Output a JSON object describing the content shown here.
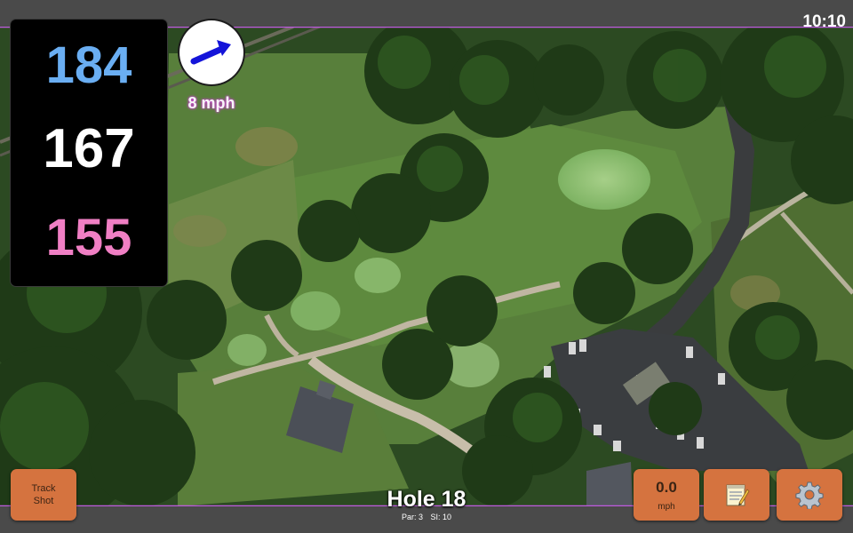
{
  "status_bar": {
    "time": "10:10"
  },
  "distances": {
    "back": "184",
    "middle": "167",
    "front": "155",
    "colors": {
      "back": "#6aaef2",
      "middle": "#ffffff",
      "front": "#f07fc4"
    }
  },
  "wind": {
    "speed_label": "8 mph",
    "direction_icon": "arrow-right-up-icon"
  },
  "hole": {
    "title": "Hole 18",
    "par": "Par: 3",
    "stroke_index": "SI: 10"
  },
  "buttons": {
    "track_shot_line1": "Track",
    "track_shot_line2": "Shot",
    "speed_value": "0.0",
    "speed_unit": "mph",
    "notes_icon": "notepad-icon",
    "settings_icon": "gear-icon"
  },
  "colors": {
    "button_fill": "#d5733f",
    "panel_bg": "#000000",
    "frame": "#4a4a4a"
  }
}
